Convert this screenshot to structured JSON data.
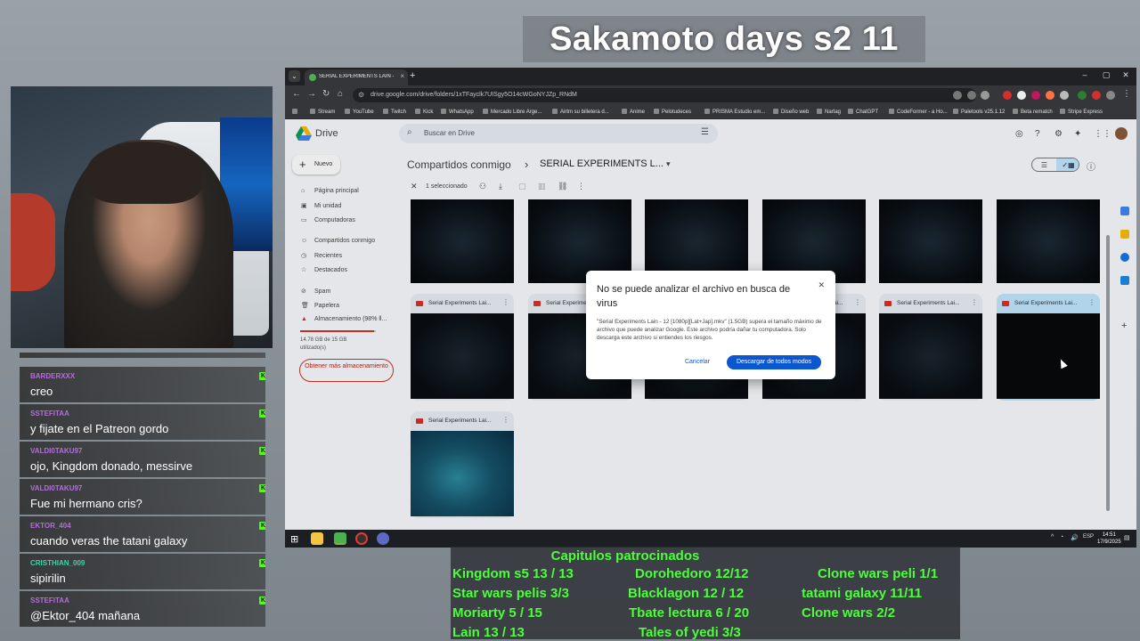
{
  "stream_title": "Sakamoto days s2 11",
  "browser": {
    "tab_title": "SERIAL EXPERIMENTS LAIN - G",
    "url": "drive.google.com/drive/folders/1xTFayclk7UISgy5O14cWGoNYJZp_RNdM",
    "bookmarks": [
      "Stream",
      "YouTube",
      "Twitch",
      "Kick",
      "WhatsApp",
      "Mercado Libre Arge...",
      "Airtm su billetera d...",
      "Anime",
      "Pelotudeces",
      "PRISMA Estudio em...",
      "Diseño web",
      "Nartag",
      "ChatGPT",
      "CodeFormer - a Ho...",
      "Paletools v25.1.12",
      "Beta rematch",
      "Stripe Express"
    ]
  },
  "drive": {
    "app_name": "Drive",
    "search_placeholder": "Buscar en Drive",
    "new_label": "Nuevo",
    "sidebar": [
      {
        "label": "Página principal",
        "icon": "home-icon"
      },
      {
        "label": "Mi unidad",
        "icon": "drive-icon"
      },
      {
        "label": "Computadoras",
        "icon": "computer-icon"
      },
      {
        "label": "Compartidos conmigo",
        "icon": "shared-icon"
      },
      {
        "label": "Recientes",
        "icon": "clock-icon"
      },
      {
        "label": "Destacados",
        "icon": "star-icon"
      },
      {
        "label": "Spam",
        "icon": "spam-icon"
      },
      {
        "label": "Papelera",
        "icon": "trash-icon"
      },
      {
        "label": "Almacenamiento (98% ll...",
        "icon": "warning-icon"
      }
    ],
    "storage_text": "14.78 GB de 15 GB utilizado(s)",
    "storage_fraction": 0.98,
    "get_more_label": "Obtener más almacenamiento",
    "breadcrumb": [
      "Compartidos conmigo",
      "SERIAL EXPERIMENTS L..."
    ],
    "selection_count": "1 seleccionado",
    "file_name": "Serial Experiments Lai..."
  },
  "dialog": {
    "title": "No se puede analizar el archivo en busca de virus",
    "body": "\"Serial Experiments Lain - 12 [1080p][Lat+Jap].mkv\" (1.5GB) supera el tamaño máximo de archivo que puede analizar Google. Este archivo podría dañar tu computadora. Solo descarga este archivo si entiendes los riesgos.",
    "cancel_label": "Cancelar",
    "download_label": "Descargar de todos modos"
  },
  "taskbar": {
    "language": "ESP",
    "time": "14:51",
    "date": "17/9/2025"
  },
  "chat": [
    {
      "user": "BARDERXXX",
      "text": "creo",
      "color": "#b36fd8"
    },
    {
      "user": "SSTEFITAA",
      "text": "y fijate en el Patreon gordo",
      "color": "#b36fd8"
    },
    {
      "user": "VALDI0TAKU97",
      "text": "ojo, Kingdom donado, messirve",
      "color": "#b36fd8"
    },
    {
      "user": "VALDI0TAKU97",
      "text": "Fue mi hermano cris?",
      "color": "#b36fd8"
    },
    {
      "user": "EKTOR_404",
      "text": "cuando veras the tatani galaxy",
      "color": "#b36fd8"
    },
    {
      "user": "CRISTHIAN_009",
      "text": "sipirilin",
      "color": "#3fd3a8"
    },
    {
      "user": "SSTEFITAA",
      "text": "@Ektor_404 mañana",
      "color": "#b36fd8"
    }
  ],
  "chat_badge": "K",
  "sponsored": {
    "title": "Capitulos patrocinados",
    "items": [
      "Kingdom s5 13 / 13",
      "Dorohedoro 12/12",
      "Clone wars peli 1/1",
      "Star wars pelis 3/3",
      "Blacklagon 12 / 12",
      "tatami galaxy 11/11",
      "Moriarty 5 / 15",
      "Tbate lectura 6 / 20",
      "Clone wars 2/2",
      "Lain 13 / 13",
      "Tales of yedi 3/3"
    ]
  }
}
